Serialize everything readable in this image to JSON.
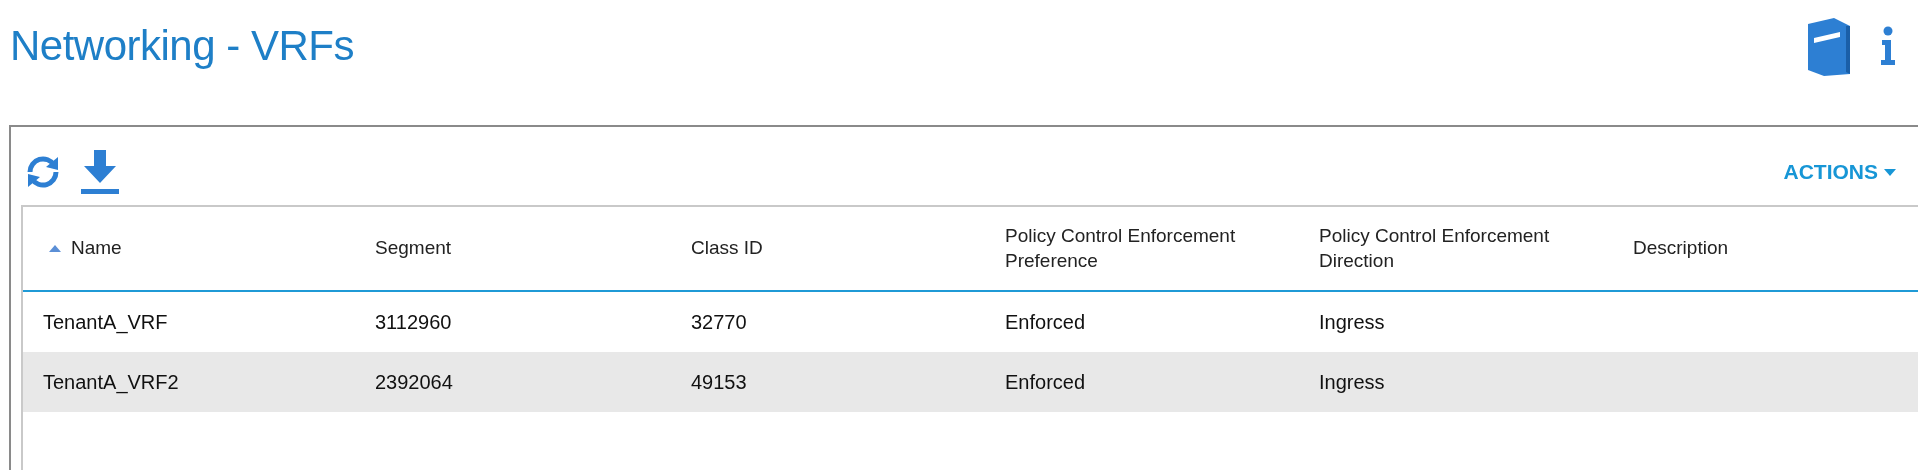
{
  "page": {
    "title": "Networking - VRFs"
  },
  "toolbar": {
    "actions_label": "ACTIONS"
  },
  "table": {
    "columns": [
      {
        "label": "Name",
        "sorted": true
      },
      {
        "label": "Segment",
        "sorted": false
      },
      {
        "label": "Class ID",
        "sorted": false
      },
      {
        "label": "Policy Control Enforcement Preference",
        "sorted": false
      },
      {
        "label": "Policy Control Enforcement Direction",
        "sorted": false
      },
      {
        "label": "Description",
        "sorted": false
      }
    ],
    "rows": [
      {
        "selected": false,
        "cells": [
          "TenantA_VRF",
          "3112960",
          "32770",
          "Enforced",
          "Ingress"
        ]
      },
      {
        "selected": true,
        "cells": [
          "TenantA_VRF2",
          "2392064",
          "49153",
          "Enforced",
          "Ingress"
        ]
      }
    ]
  }
}
